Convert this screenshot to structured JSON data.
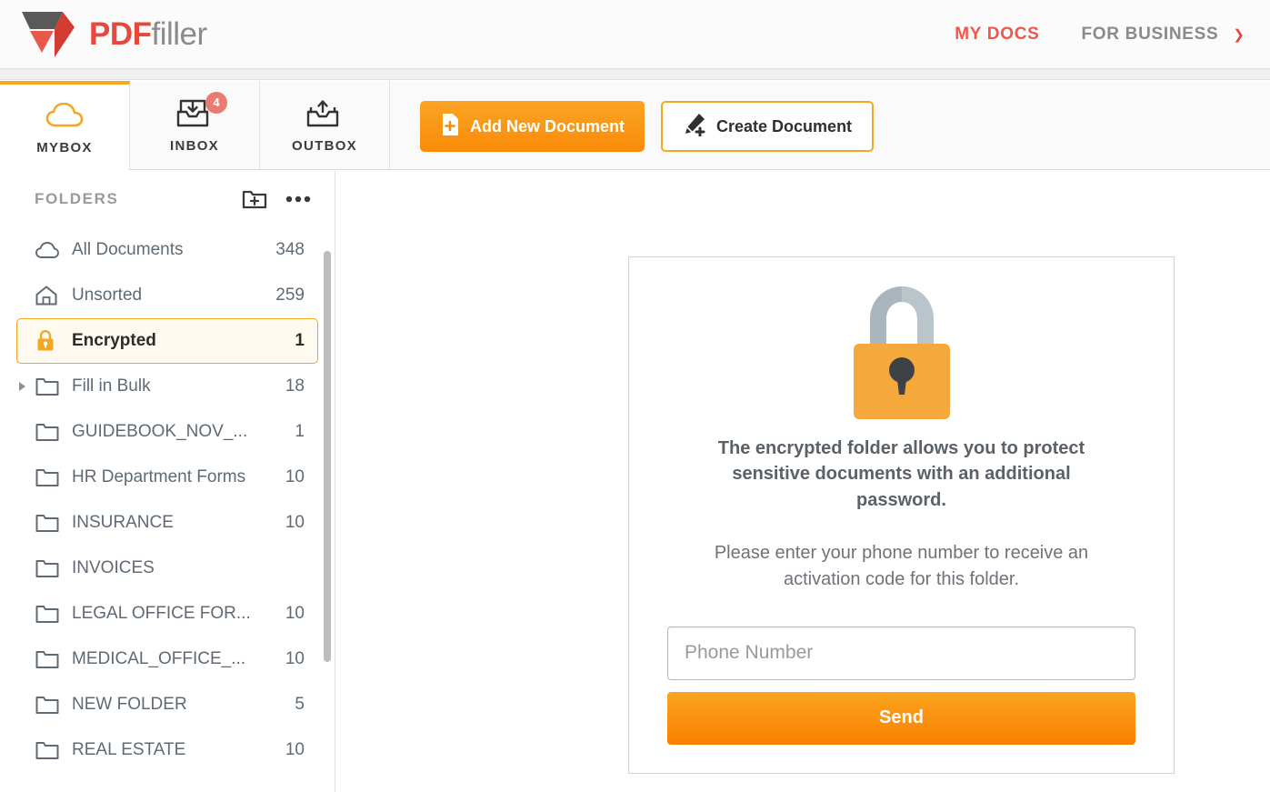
{
  "header": {
    "logo": {
      "icon": "pdffiller-funnel-logo",
      "name_primary": "PDF",
      "name_secondary": "filler",
      "color_primary": "#e8483b",
      "color_secondary": "#8b8b8b"
    },
    "nav": [
      {
        "label": "MY DOCS",
        "state": "active",
        "color": "#f2564a"
      },
      {
        "label": "FOR BUSINESS",
        "state": "default",
        "color": "#8a8a8a",
        "caret": "chevron-down-icon"
      }
    ]
  },
  "tabs": [
    {
      "label": "MYBOX",
      "icon": "cloud-icon",
      "active": true,
      "badge": null
    },
    {
      "label": "INBOX",
      "icon": "inbox-down-icon",
      "active": false,
      "badge": "4"
    },
    {
      "label": "OUTBOX",
      "icon": "outbox-up-icon",
      "active": false,
      "badge": null
    }
  ],
  "toolbar": {
    "add_document_label": "Add New Document",
    "add_document_icon": "document-plus-icon",
    "create_document_label": "Create Document",
    "create_document_icon": "pen-plus-icon"
  },
  "sidebar": {
    "title": "FOLDERS",
    "new_folder_icon": "new-folder-icon",
    "more_icon": "more-options-icon",
    "items": [
      {
        "label": "All Documents",
        "count": "348",
        "icon": "cloud-icon",
        "selected": false,
        "expandable": false
      },
      {
        "label": "Unsorted",
        "count": "259",
        "icon": "home-icon",
        "selected": false,
        "expandable": false
      },
      {
        "label": "Encrypted",
        "count": "1",
        "icon": "lock-icon",
        "selected": true,
        "expandable": false
      },
      {
        "label": "Fill in Bulk",
        "count": "18",
        "icon": "folder-icon",
        "selected": false,
        "expandable": true
      },
      {
        "label": "GUIDEBOOK_NOV_...",
        "count": "1",
        "icon": "folder-icon",
        "selected": false,
        "expandable": false
      },
      {
        "label": "HR Department Forms",
        "count": "10",
        "icon": "folder-icon",
        "selected": false,
        "expandable": false
      },
      {
        "label": "INSURANCE",
        "count": "10",
        "icon": "folder-icon",
        "selected": false,
        "expandable": false
      },
      {
        "label": "INVOICES",
        "count": "",
        "icon": "folder-icon",
        "selected": false,
        "expandable": false
      },
      {
        "label": "LEGAL OFFICE FOR...",
        "count": "10",
        "icon": "folder-icon",
        "selected": false,
        "expandable": false
      },
      {
        "label": "MEDICAL_OFFICE_...",
        "count": "10",
        "icon": "folder-icon",
        "selected": false,
        "expandable": false
      },
      {
        "label": "NEW FOLDER",
        "count": "5",
        "icon": "folder-icon",
        "selected": false,
        "expandable": false
      },
      {
        "label": "REAL ESTATE",
        "count": "10",
        "icon": "folder-icon",
        "selected": false,
        "expandable": false
      }
    ]
  },
  "main": {
    "lock_icon": "padlock-icon",
    "heading": "The encrypted folder allows you to protect sensitive documents with an additional password.",
    "subtext": "Please enter your phone number to receive an activation code for this folder.",
    "phone_placeholder": "Phone Number",
    "phone_value": "",
    "send_label": "Send"
  },
  "colors": {
    "accent_orange": "#f5a623",
    "button_orange": "#fb8000",
    "brand_red": "#e8483b",
    "badge_coral": "#ea7b72",
    "lock_body": "#f5a93c",
    "lock_shackle": "#aab6bd"
  }
}
